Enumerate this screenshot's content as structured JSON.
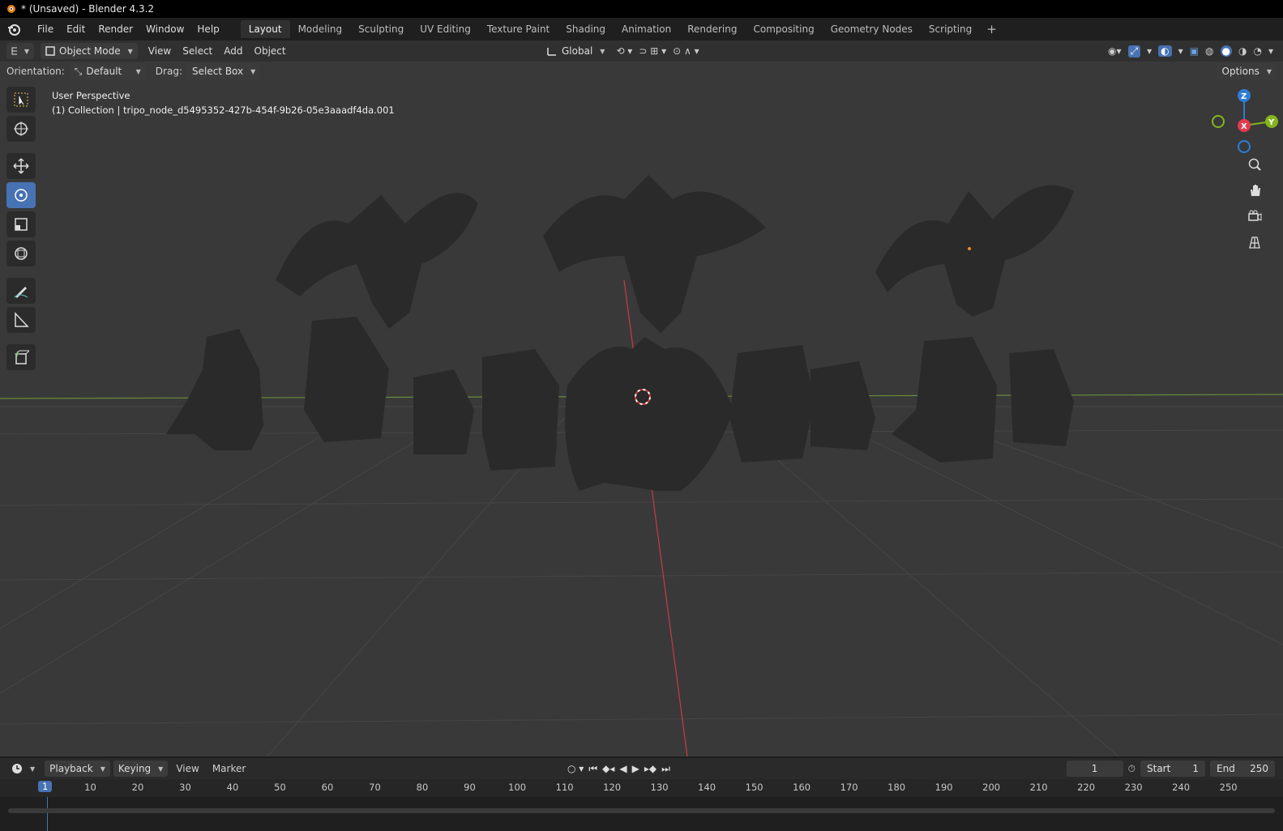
{
  "title_bar": {
    "text": "* (Unsaved) - Blender 4.3.2"
  },
  "menu": [
    "File",
    "Edit",
    "Render",
    "Window",
    "Help"
  ],
  "workspaces": [
    "Layout",
    "Modeling",
    "Sculpting",
    "UV Editing",
    "Texture Paint",
    "Shading",
    "Animation",
    "Rendering",
    "Compositing",
    "Geometry Nodes",
    "Scripting"
  ],
  "active_workspace": "Layout",
  "header": {
    "mode": "Object Mode",
    "view_menus": [
      "View",
      "Select",
      "Add",
      "Object"
    ],
    "transform_orientation": "Global"
  },
  "tool_settings": {
    "orientation_label": "Orientation:",
    "orientation_value": "Default",
    "drag_label": "Drag:",
    "drag_value": "Select Box",
    "options_label": "Options"
  },
  "viewport": {
    "view_name": "User Perspective",
    "collection_line": "(1) Collection | tripo_node_d5495352-427b-454f-9b26-05e3aaadf4da.001",
    "gizmo_axes": {
      "z": "Z",
      "x": "X",
      "y": "Y"
    }
  },
  "colors": {
    "accent": "#4772b3",
    "axis_x": "#e13b4e",
    "axis_y": "#84b51c",
    "axis_z": "#2d7dd5"
  },
  "timeline": {
    "menus": [
      "Playback",
      "Keying",
      "View",
      "Marker"
    ],
    "current_frame": "1",
    "start_label": "Start",
    "start_value": "1",
    "end_label": "End",
    "end_value": "250",
    "ruler_ticks": [
      "1",
      "10",
      "20",
      "30",
      "40",
      "50",
      "60",
      "70",
      "80",
      "90",
      "100",
      "110",
      "120",
      "130",
      "140",
      "150",
      "160",
      "170",
      "180",
      "190",
      "200",
      "210",
      "220",
      "230",
      "240",
      "250"
    ]
  }
}
